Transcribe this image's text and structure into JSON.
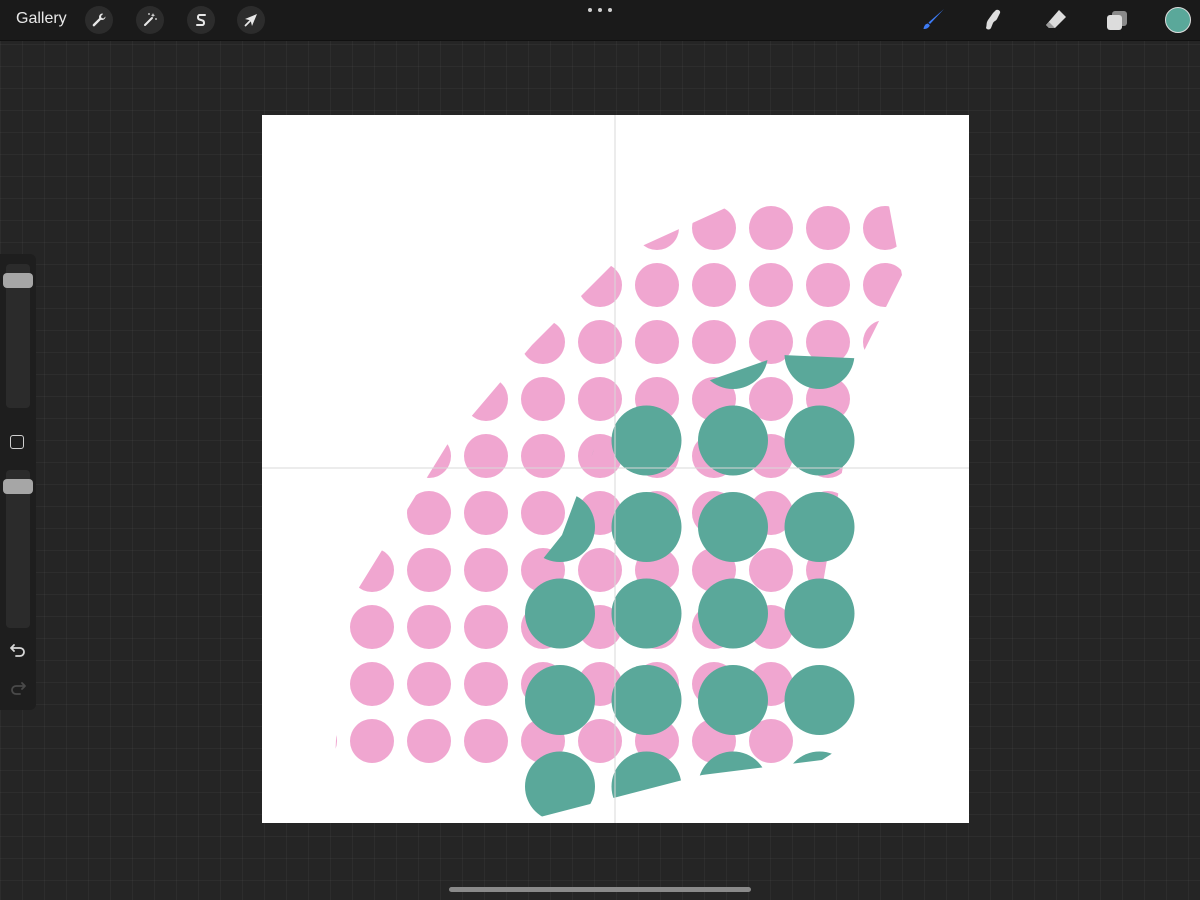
{
  "topbar": {
    "gallery_label": "Gallery",
    "left_tools": [
      {
        "icon": "wrench-icon",
        "name": "actions"
      },
      {
        "icon": "magic-wand-icon",
        "name": "adjustments"
      },
      {
        "icon": "selection-s-icon",
        "name": "selection"
      },
      {
        "icon": "arrow-cursor-icon",
        "name": "transform"
      }
    ],
    "right_tools": [
      {
        "icon": "brush-icon",
        "name": "brush",
        "active": true
      },
      {
        "icon": "smudge-icon",
        "name": "smudge"
      },
      {
        "icon": "eraser-icon",
        "name": "eraser"
      },
      {
        "icon": "layers-icon",
        "name": "layers"
      }
    ],
    "active_color": "#5aa89a",
    "active_tool_color": "#3d7bf5"
  },
  "sidebar": {
    "brush_size_level": 0.08,
    "opacity_level": 0.08
  },
  "canvas": {
    "background": "#ffffff",
    "pink_color": "#f0a6d0",
    "teal_color": "#5aa89a",
    "guide_color": "#d8d8d8"
  }
}
